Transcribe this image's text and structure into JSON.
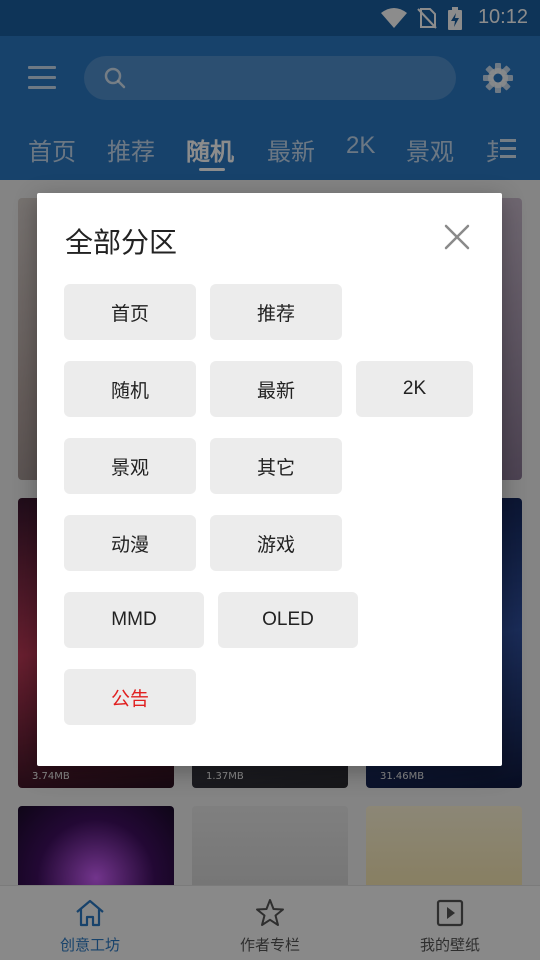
{
  "status_bar": {
    "time": "10:12"
  },
  "header": {
    "search": {
      "placeholder": ""
    },
    "tabs": [
      {
        "label": "首页"
      },
      {
        "label": "推荐"
      },
      {
        "label": "随机"
      },
      {
        "label": "最新"
      },
      {
        "label": "2K"
      },
      {
        "label": "景观"
      },
      {
        "label": "其"
      }
    ],
    "active_tab": "随机",
    "colors": {
      "accent": "#2a78c4",
      "status": "#1a5fa0"
    }
  },
  "content": {
    "cards": [
      {
        "size": "3.74MB"
      },
      {
        "size": "1.37MB"
      },
      {
        "size": "31.46MB"
      }
    ]
  },
  "bottom_nav": [
    {
      "label": "创意工坊",
      "icon": "home-icon",
      "active": true
    },
    {
      "label": "作者专栏",
      "icon": "star-icon",
      "active": false
    },
    {
      "label": "我的壁纸",
      "icon": "play-square-icon",
      "active": false
    }
  ],
  "dialog": {
    "title": "全部分区",
    "close_icon": "close-icon",
    "categories": [
      {
        "label": "首页"
      },
      {
        "label": "推荐"
      },
      {
        "label": "随机"
      },
      {
        "label": "最新"
      },
      {
        "label": "2K"
      },
      {
        "label": "景观"
      },
      {
        "label": "其它"
      },
      {
        "label": "动漫"
      },
      {
        "label": "游戏"
      },
      {
        "label": "MMD"
      },
      {
        "label": "OLED"
      },
      {
        "label": "公告",
        "color": "#e02020"
      }
    ]
  }
}
